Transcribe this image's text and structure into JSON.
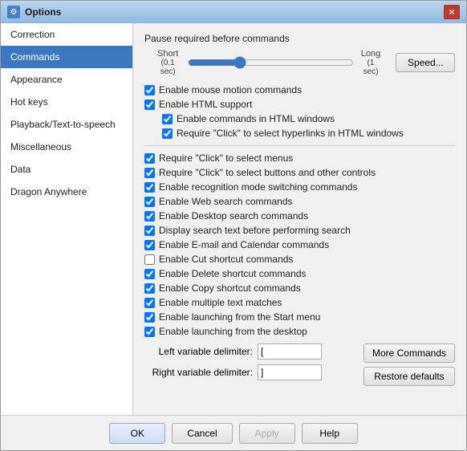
{
  "window": {
    "title": "Options",
    "icon": "⚙"
  },
  "sidebar": {
    "items": [
      {
        "id": "correction",
        "label": "Correction",
        "active": false
      },
      {
        "id": "commands",
        "label": "Commands",
        "active": true
      },
      {
        "id": "appearance",
        "label": "Appearance",
        "active": false
      },
      {
        "id": "hot-keys",
        "label": "Hot keys",
        "active": false
      },
      {
        "id": "playback",
        "label": "Playback/Text-to-speech",
        "active": false
      },
      {
        "id": "miscellaneous",
        "label": "Miscellaneous",
        "active": false
      },
      {
        "id": "data",
        "label": "Data",
        "active": false
      },
      {
        "id": "dragon-anywhere",
        "label": "Dragon Anywhere",
        "active": false
      }
    ]
  },
  "main": {
    "pause_label": "Pause required before commands",
    "slider": {
      "left_label": "Short",
      "left_sub": "(0.1 sec)",
      "right_label": "Long",
      "right_sub": "(1 sec)",
      "value": 30
    },
    "speed_button": "Speed...",
    "checkboxes": [
      {
        "id": "mouse-motion",
        "label": "Enable mouse motion commands",
        "checked": true,
        "indent": 0
      },
      {
        "id": "html-support",
        "label": "Enable HTML support",
        "checked": true,
        "indent": 0
      },
      {
        "id": "html-commands",
        "label": "Enable commands in HTML windows",
        "checked": true,
        "indent": 1
      },
      {
        "id": "html-hyperlinks",
        "label": "Require \"Click\" to select hyperlinks in HTML windows",
        "checked": true,
        "indent": 1
      }
    ],
    "checkboxes2": [
      {
        "id": "click-menus",
        "label": "Require \"Click\" to select menus",
        "checked": true,
        "indent": 0
      },
      {
        "id": "click-buttons",
        "label": "Require \"Click\" to select buttons and other controls",
        "checked": true,
        "indent": 0
      },
      {
        "id": "recognition-mode",
        "label": "Enable recognition mode switching commands",
        "checked": true,
        "indent": 0
      },
      {
        "id": "web-search",
        "label": "Enable Web search commands",
        "checked": true,
        "indent": 0
      },
      {
        "id": "desktop-search",
        "label": "Enable Desktop search commands",
        "checked": true,
        "indent": 0
      },
      {
        "id": "display-search",
        "label": "Display search text before performing search",
        "checked": true,
        "indent": 0
      },
      {
        "id": "email-calendar",
        "label": "Enable E-mail and Calendar commands",
        "checked": true,
        "indent": 0
      },
      {
        "id": "cut-shortcut",
        "label": "Enable Cut shortcut commands",
        "checked": false,
        "indent": 0
      },
      {
        "id": "delete-shortcut",
        "label": "Enable Delete shortcut commands",
        "checked": true,
        "indent": 0
      },
      {
        "id": "copy-shortcut",
        "label": "Enable Copy shortcut commands",
        "checked": true,
        "indent": 0
      },
      {
        "id": "multiple-text",
        "label": "Enable multiple text matches",
        "checked": true,
        "indent": 0
      },
      {
        "id": "start-menu",
        "label": "Enable launching from the Start menu",
        "checked": true,
        "indent": 0
      },
      {
        "id": "desktop-launch",
        "label": "Enable launching from the desktop",
        "checked": true,
        "indent": 0
      }
    ],
    "left_delimiter_label": "Left variable delimiter:",
    "left_delimiter_value": "[",
    "right_delimiter_label": "Right variable delimiter:",
    "right_delimiter_value": "]",
    "more_commands_btn": "More Commands",
    "restore_defaults_btn": "Restore defaults"
  },
  "bottom": {
    "ok_label": "OK",
    "cancel_label": "Cancel",
    "apply_label": "Apply",
    "help_label": "Help"
  }
}
